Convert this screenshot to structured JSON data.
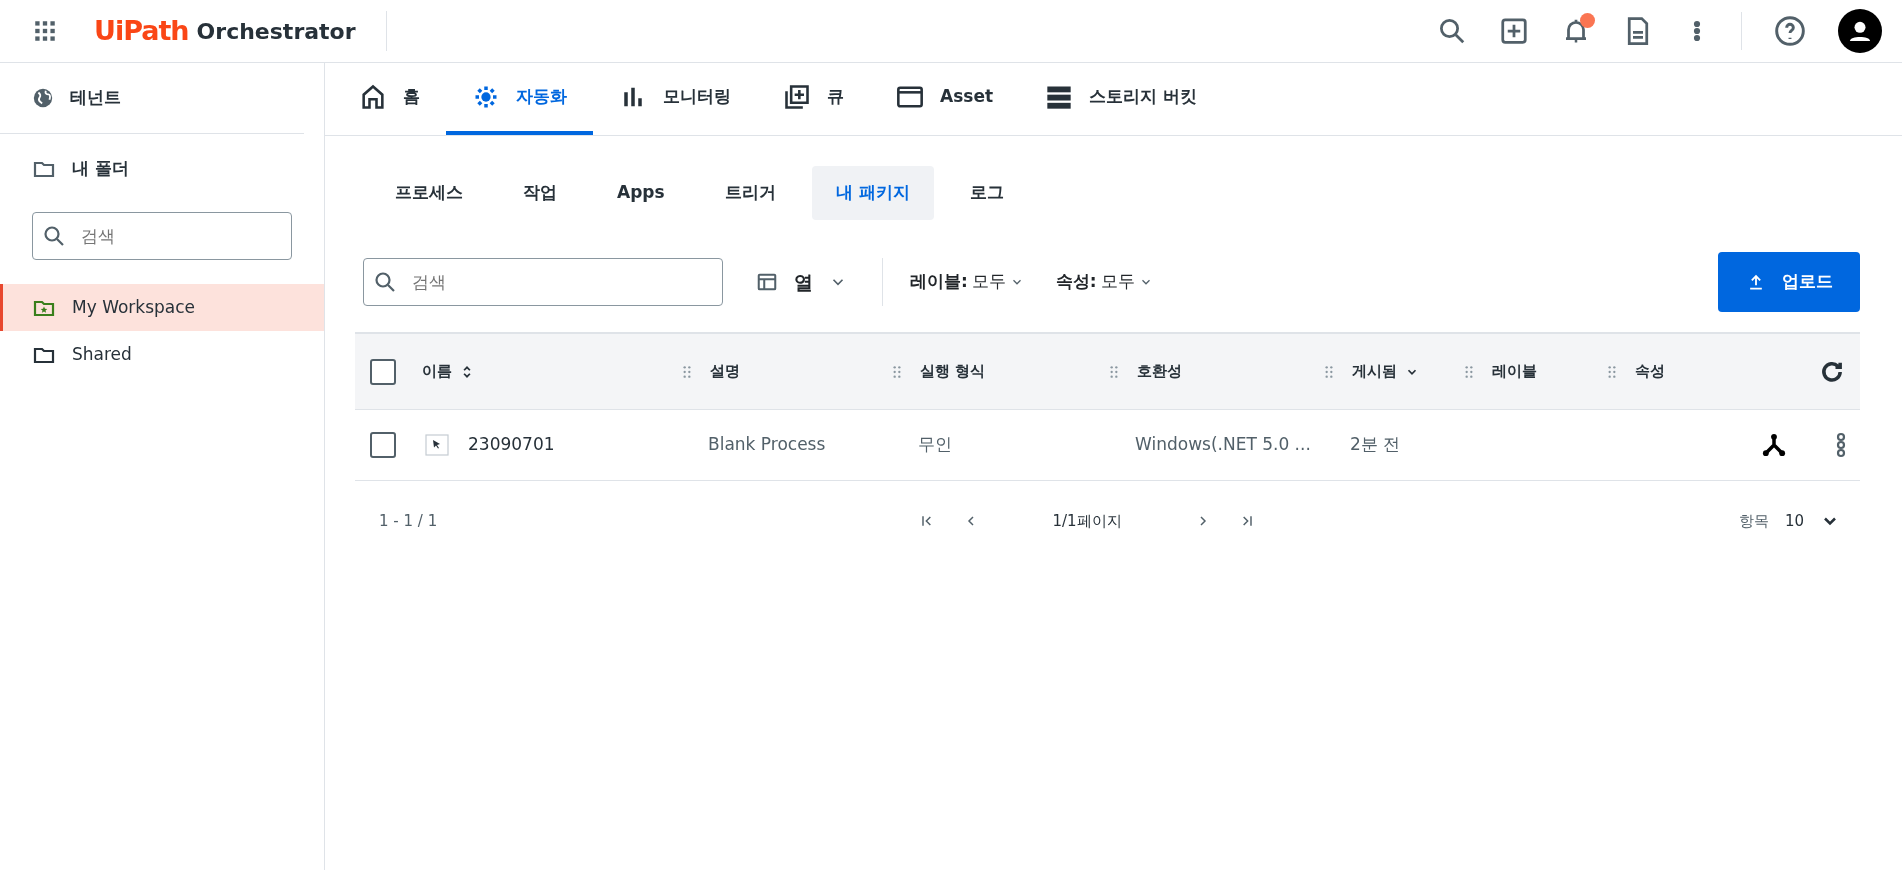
{
  "header": {
    "logo_brand": "UiPath",
    "logo_product": "Orchestrator",
    "notification_badge": true
  },
  "sidebar": {
    "tenant": "테넌트",
    "folder_title": "내 폴더",
    "search": {
      "placeholder": "검색"
    },
    "items": [
      {
        "label": "My Workspace",
        "kind": "workspace",
        "selected": true
      },
      {
        "label": "Shared",
        "kind": "folder",
        "selected": false
      }
    ]
  },
  "main_tabs": [
    {
      "label": "홈",
      "kind": "home",
      "selected": false
    },
    {
      "label": "자동화",
      "kind": "gear",
      "selected": true
    },
    {
      "label": "모니터링",
      "kind": "bars",
      "selected": false
    },
    {
      "label": "큐",
      "kind": "queue",
      "selected": false
    },
    {
      "label": "Asset",
      "kind": "window",
      "selected": false
    },
    {
      "label": "스토리지 버킷",
      "kind": "storage",
      "selected": false
    }
  ],
  "sub_tabs": [
    {
      "label": "프로세스",
      "selected": false
    },
    {
      "label": "작업",
      "selected": false
    },
    {
      "label": "Apps",
      "selected": false
    },
    {
      "label": "트리거",
      "selected": false
    },
    {
      "label": "내 패키지",
      "selected": true
    },
    {
      "label": "로그",
      "selected": false
    }
  ],
  "toolbar": {
    "search": {
      "placeholder": "검색"
    },
    "columns_button": "열",
    "filters": [
      {
        "label": "레이블:",
        "value": "모두"
      },
      {
        "label": "속성:",
        "value": "모두"
      }
    ],
    "upload_button": "업로드"
  },
  "table": {
    "all_checked": false,
    "columns": [
      {
        "label": "이름",
        "kind": "sortable"
      },
      {
        "label": "설명",
        "kind": "plain"
      },
      {
        "label": "실행 형식",
        "kind": "plain"
      },
      {
        "label": "호환성",
        "kind": "plain"
      },
      {
        "label": "게시됨",
        "kind": "sorted"
      },
      {
        "label": "레이블",
        "kind": "plain"
      },
      {
        "label": "속성",
        "kind": "plain"
      }
    ],
    "rows": [
      {
        "checked": false,
        "cells": [
          "23090701",
          "Blank Process",
          "무인",
          "Windows(.NET 5.0 ...",
          "2분 전",
          "",
          ""
        ]
      }
    ]
  },
  "pagination": {
    "range": "1 - 1 / 1",
    "page": "1/1페이지",
    "page_size_label": "항목",
    "page_size": "10"
  }
}
